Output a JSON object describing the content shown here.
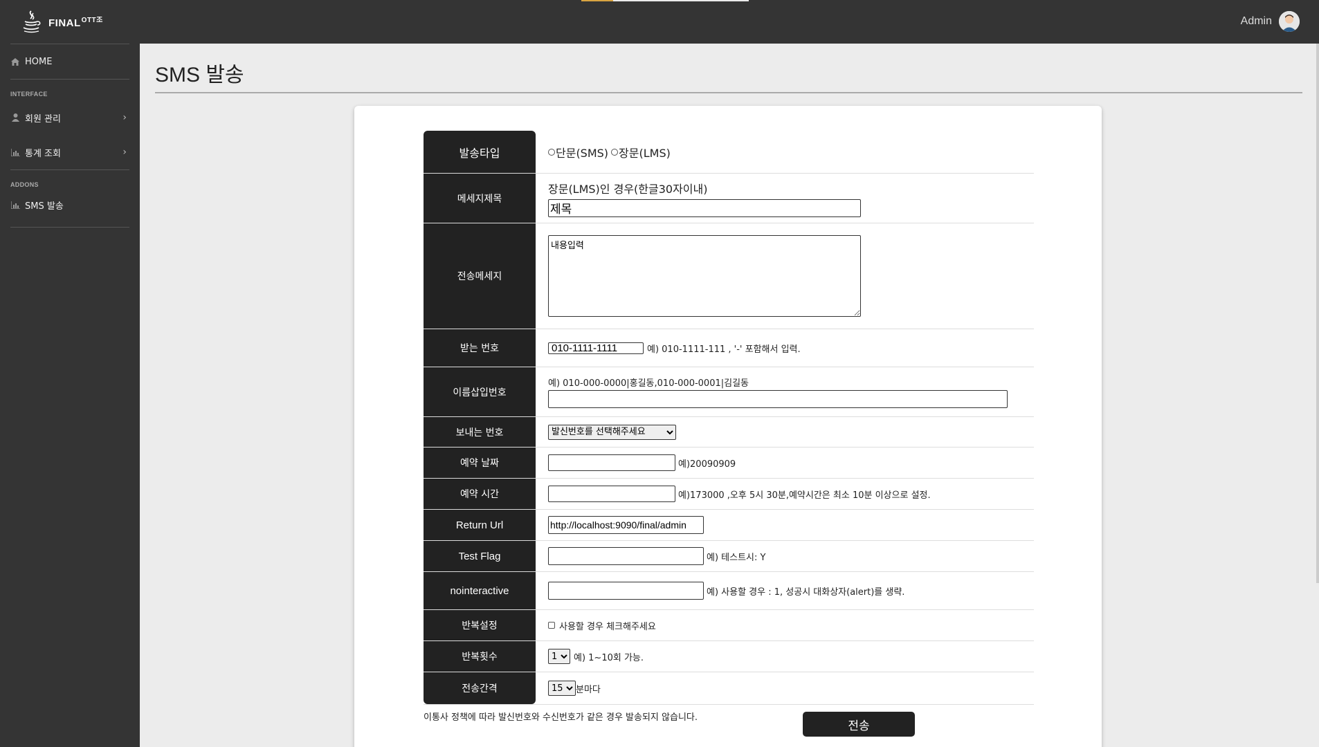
{
  "brand": {
    "name": "FINAL",
    "sup": "OTT조"
  },
  "user": {
    "name": "Admin"
  },
  "sidebar": {
    "home": "HOME",
    "interface_heading": "INTERFACE",
    "member": "회원 관리",
    "stats": "통계 조회",
    "addons_heading": "ADDONS",
    "sms": "SMS 발송"
  },
  "page": {
    "title": "SMS 발송"
  },
  "form": {
    "type_label": "발송타입",
    "type_sms": "단문(SMS)",
    "type_lms": "장문(LMS)",
    "subject_label": "메세지제목",
    "subject_hint": "장문(LMS)인 경우(한글30자이내)",
    "subject_value": "제목",
    "message_label": "전송메세지",
    "message_value": "내용입력",
    "receiver_label": "받는 번호",
    "receiver_value": "010-1111-1111",
    "receiver_hint": "예) 010-1111-111 , '-' 포함해서 입력.",
    "names_label": "이름삽입번호",
    "names_hint": "예) 010-000-0000|홍길동,010-000-0001|김길동",
    "sender_label": "보내는 번호",
    "sender_option": "발신번호를 선택해주세요",
    "rdate_label": "예약 날짜",
    "rdate_hint": "예)20090909",
    "rtime_label": "예약 시간",
    "rtime_hint": "예)173000 ,오후 5시 30분,예약시간은 최소 10분 이상으로 설정.",
    "return_label": "Return Url",
    "return_value": "http://localhost:9090/final/admin",
    "test_label": "Test Flag",
    "test_hint": "예) 테스트시: Y",
    "noninteractive_label": "nointeractive",
    "noninteractive_hint": "예) 사용할 경우 : 1, 성공시 대화상자(alert)를 생략.",
    "repeat_label": "반복설정",
    "repeat_hint": "사용할 경우 체크해주세요",
    "repeat_count_label": "반복횟수",
    "repeat_count_value": "1",
    "repeat_count_hint": "예) 1~10회 가능.",
    "interval_label": "전송간격",
    "interval_value": "15",
    "interval_hint": "분마다"
  },
  "footer": {
    "note": "이통사 정책에 따라 발신번호와 수신번호가 같은 경우 발송되지 않습니다.",
    "send": "전송"
  }
}
